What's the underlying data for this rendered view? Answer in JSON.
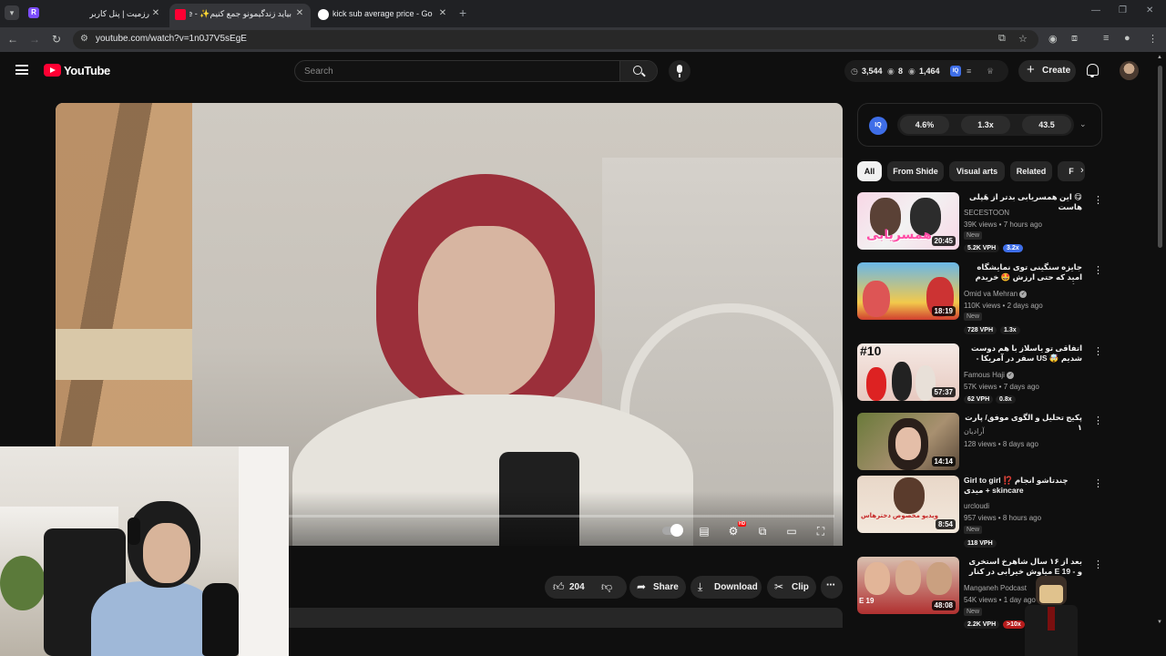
{
  "browser": {
    "tabs": [
      {
        "title": "رزمیت | پنل کاربری",
        "favicon_color": "#7c4dff"
      },
      {
        "title": "بیاید زندگیمونو جمع کنیم✨ - YouTube",
        "favicon_color": "#ff0033"
      },
      {
        "title": "kick sub average price - Google Search",
        "favicon_color": "#4285f4"
      }
    ],
    "url": "youtube.com/watch?v=1n0J7V5sEgE"
  },
  "masthead": {
    "logo_text": "YouTube",
    "search_placeholder": "Search",
    "ext_stats": {
      "views": "3,544",
      "watching": "8",
      "impressions": "1,464"
    },
    "create_label": "Create"
  },
  "player": {
    "hd_badge": "HD",
    "controls": [
      "autoplay-toggle",
      "captions",
      "settings",
      "miniplayer",
      "theater",
      "fullscreen"
    ]
  },
  "actions": {
    "like_count": "204",
    "share_label": "Share",
    "download_label": "Download",
    "clip_label": "Clip",
    "more_label": "⋯"
  },
  "iq_panel": {
    "logo": "IQ",
    "stats": [
      "4.6%",
      "1.3x",
      "43.5"
    ]
  },
  "chips": [
    "All",
    "From Shide",
    "Visual arts",
    "Related",
    "F"
  ],
  "recommendations": [
    {
      "title": "😋 این همسریابی بدتر از هَپلی هاست",
      "channel": "SECESTOON",
      "verified": false,
      "meta": "39K views • 7 hours ago",
      "badge": "New",
      "vph": "5.2K VPH",
      "multiplier": "3.2x",
      "duration": "20:45",
      "thumb_text": "همسریابی"
    },
    {
      "title": "جایزه سنگینی توی نمایشگاه امید که حتی ارزش 🤩 خریدم نداشت",
      "channel": "Omid va Mehran",
      "verified": true,
      "meta": "110K views • 2 days ago",
      "badge": "New",
      "vph": "728 VPH",
      "multiplier": "1.3x",
      "duration": "18:19",
      "thumb_text": ""
    },
    {
      "title": "اتفاقی تو یاسلاز با هم دوست شدیم 🤯 US سفر در آمریکا - قسمت ۱۰",
      "channel": "Famous Haji",
      "verified": true,
      "meta": "57K views • 7 days ago",
      "badge": "",
      "vph": "62 VPH",
      "multiplier": "0.8x",
      "duration": "57:37",
      "thumb_text": "#10"
    },
    {
      "title": "پکیج تحلیل و الگوی موفق/ پارت ۱",
      "channel": "آرادیان",
      "verified": false,
      "meta": "128 views • 8 days ago",
      "badge": "",
      "vph": "",
      "multiplier": "",
      "duration": "14:14",
      "thumb_text": ""
    },
    {
      "title": "Girl to girl ⁉️ چندتاشو انجام میدی + skincare",
      "channel": "urcloudi",
      "verified": false,
      "meta": "957 views • 8 hours ago",
      "badge": "New",
      "vph": "118 VPH",
      "multiplier": "",
      "duration": "8:54",
      "thumb_text": "ویدیو مخصوص دخترهاس"
    },
    {
      "title": "بعد از ۱۶ سال شاهرخ استخری و - E 19 میاوش خیرابی در کنار هم",
      "channel": "Manganeh Podcast",
      "verified": false,
      "meta": "54K views • 1 day ago",
      "badge": "New",
      "vph": "2.2K VPH",
      "multiplier": ">10x",
      "duration": "48:08",
      "thumb_text": "E 19"
    }
  ],
  "colors": {
    "bg": "#0f0f0f",
    "chip_bg": "#272727",
    "accent_red": "#ff0033",
    "vph_blue": "#3e6ee8"
  }
}
